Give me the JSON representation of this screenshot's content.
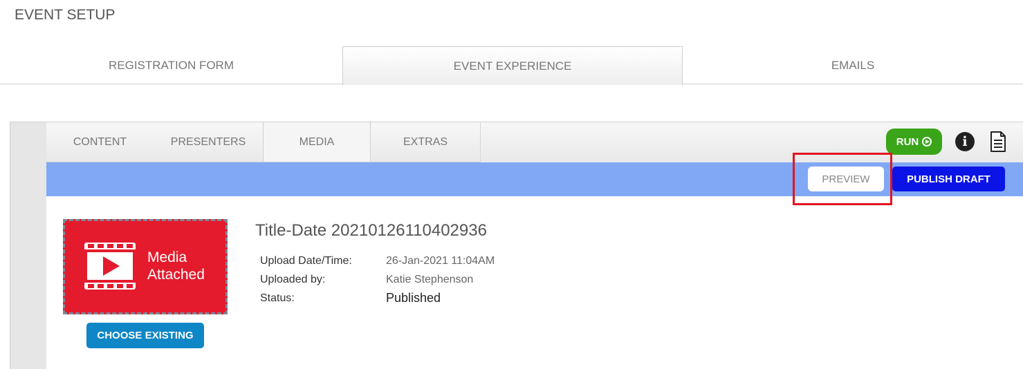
{
  "page": {
    "title": "EVENT SETUP"
  },
  "main_tabs": [
    {
      "label": "REGISTRATION FORM"
    },
    {
      "label": "EVENT EXPERIENCE"
    },
    {
      "label": "EMAILS"
    }
  ],
  "sub_tabs": [
    {
      "label": "CONTENT"
    },
    {
      "label": "PRESENTERS"
    },
    {
      "label": "MEDIA"
    },
    {
      "label": "EXTRAS"
    }
  ],
  "toolbar": {
    "run_label": "RUN",
    "preview_label": "PREVIEW",
    "publish_label": "PUBLISH DRAFT"
  },
  "media": {
    "thumb_label_line1": "Media",
    "thumb_label_line2": "Attached",
    "choose_label": "CHOOSE EXISTING",
    "title": "Title-Date 20210126110402936",
    "fields": [
      {
        "label": "Upload Date/Time:",
        "value": "26-Jan-2021 11:04AM"
      },
      {
        "label": "Uploaded by:",
        "value": "Katie Stephenson"
      },
      {
        "label": "Status:",
        "value": "Published"
      }
    ]
  },
  "colors": {
    "run": "#3aa519",
    "bluebar": "#80a8f4",
    "publish": "#0b14e6",
    "choose": "#0f86c6",
    "media_thumb": "#e41b2d",
    "highlight": "#e3141f"
  }
}
